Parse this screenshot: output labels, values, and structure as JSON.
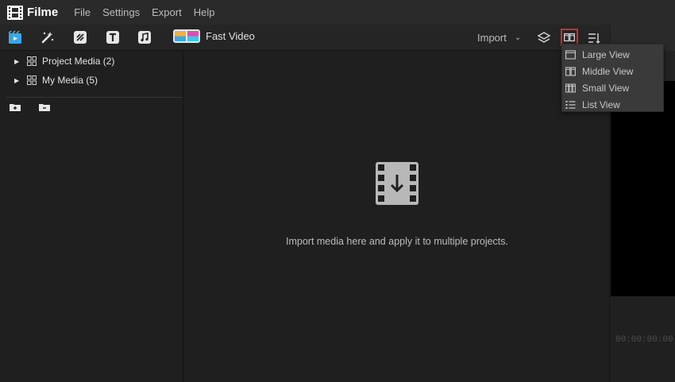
{
  "app": {
    "name": "Filme",
    "menu": [
      "File",
      "Settings",
      "Export",
      "Help"
    ]
  },
  "toolbar": {
    "tabs": [
      {
        "icon": "media-icon",
        "active": true
      },
      {
        "icon": "effects-icon"
      },
      {
        "icon": "transitions-icon"
      },
      {
        "icon": "text-icon"
      },
      {
        "icon": "audio-icon"
      }
    ],
    "fast_video_label": "Fast Video",
    "import_label": "Import",
    "colors": {
      "accent": "#3ba7e6",
      "highlight_border": "#d22b2b"
    }
  },
  "tree": {
    "items": [
      {
        "label": "Project Media (2)"
      },
      {
        "label": "My Media (5)"
      }
    ]
  },
  "center": {
    "empty_message": "Import media here and apply it to multiple projects."
  },
  "preview": {
    "timecode": "00:00:00:00"
  },
  "view_menu": {
    "items": [
      {
        "label": "Large View",
        "icon": "large-view-icon"
      },
      {
        "label": "Middle View",
        "icon": "middle-view-icon"
      },
      {
        "label": "Small View",
        "icon": "small-view-icon"
      },
      {
        "label": "List View",
        "icon": "list-view-icon"
      }
    ]
  }
}
